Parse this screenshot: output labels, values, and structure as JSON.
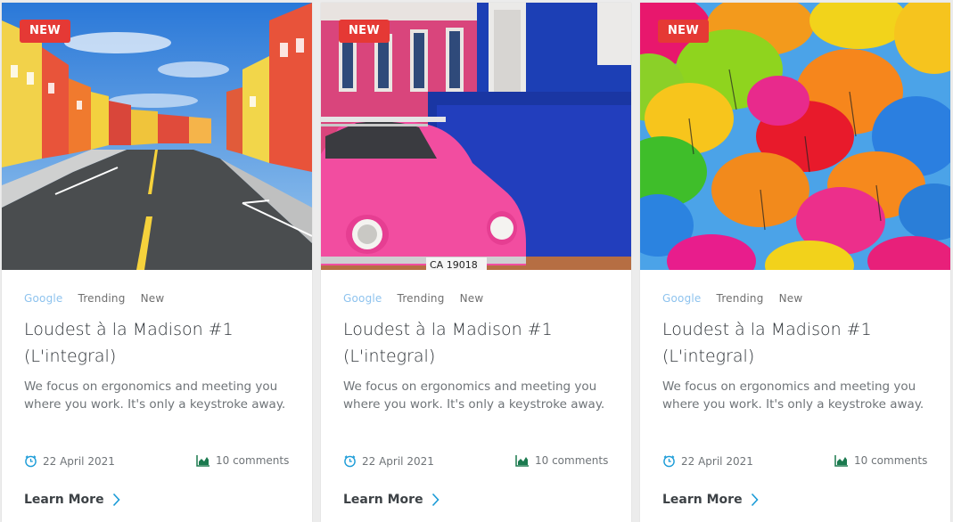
{
  "colors": {
    "badge": "#e53935",
    "tag_link": "#8ec3ee",
    "icon": "#1a9bd7",
    "chart_icon": "#1b7a4f",
    "chevron": "#1a9bd7"
  },
  "cards": [
    {
      "image_subject": "colorful street with houses",
      "badge": "NEW",
      "tags": [
        "Google",
        "Trending",
        "New"
      ],
      "title": "Loudest à la Madison #1 (L'integral)",
      "description": "We focus on ergonomics and meeting you where you work. It's only a keystroke away.",
      "date": "22 April 2021",
      "comments": "10 comments",
      "cta": "Learn More"
    },
    {
      "image_subject": "pink beetle car in front of blue wall",
      "badge": "NEW",
      "tags": [
        "Google",
        "Trending",
        "New"
      ],
      "title": "Loudest à la Madison #1 (L'integral)",
      "description": "We focus on ergonomics and meeting you where you work. It's only a keystroke away.",
      "date": "22 April 2021",
      "comments": "10 comments",
      "cta": "Learn More"
    },
    {
      "image_subject": "colorful umbrellas in sky",
      "badge": "NEW",
      "tags": [
        "Google",
        "Trending",
        "New"
      ],
      "title": "Loudest à la Madison #1 (L'integral)",
      "description": "We focus on ergonomics and meeting you where you work. It's only a keystroke away.",
      "date": "22 April 2021",
      "comments": "10 comments",
      "cta": "Learn More"
    }
  ]
}
